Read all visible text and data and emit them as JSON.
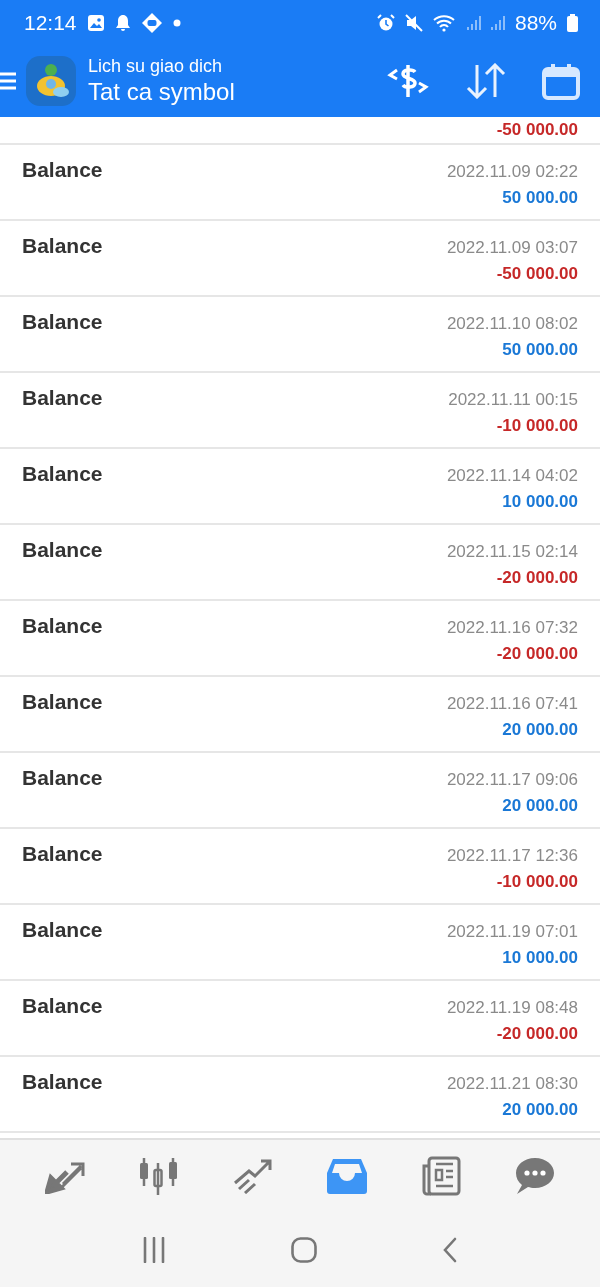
{
  "status_bar": {
    "time": "12:14",
    "battery": "88%"
  },
  "header": {
    "subtitle": "Lich su giao dich",
    "title": "Tat ca symbol"
  },
  "partial_row": {
    "amount": "-50 000.00",
    "color": "#c62828"
  },
  "rows": [
    {
      "name": "Balance",
      "time": "2022.11.09 02:22",
      "amount": "50 000.00",
      "color": "#1a78d6"
    },
    {
      "name": "Balance",
      "time": "2022.11.09 03:07",
      "amount": "-50 000.00",
      "color": "#c62828"
    },
    {
      "name": "Balance",
      "time": "2022.11.10 08:02",
      "amount": "50 000.00",
      "color": "#1a78d6"
    },
    {
      "name": "Balance",
      "time": "2022.11.11 00:15",
      "amount": "-10 000.00",
      "color": "#c62828"
    },
    {
      "name": "Balance",
      "time": "2022.11.14 04:02",
      "amount": "10 000.00",
      "color": "#1a78d6"
    },
    {
      "name": "Balance",
      "time": "2022.11.15 02:14",
      "amount": "-20 000.00",
      "color": "#c62828"
    },
    {
      "name": "Balance",
      "time": "2022.11.16 07:32",
      "amount": "-20 000.00",
      "color": "#c62828"
    },
    {
      "name": "Balance",
      "time": "2022.11.16 07:41",
      "amount": "20 000.00",
      "color": "#1a78d6"
    },
    {
      "name": "Balance",
      "time": "2022.11.17 09:06",
      "amount": "20 000.00",
      "color": "#1a78d6"
    },
    {
      "name": "Balance",
      "time": "2022.11.17 12:36",
      "amount": "-10 000.00",
      "color": "#c62828"
    },
    {
      "name": "Balance",
      "time": "2022.11.19 07:01",
      "amount": "10 000.00",
      "color": "#1a78d6"
    },
    {
      "name": "Balance",
      "time": "2022.11.19 08:48",
      "amount": "-20 000.00",
      "color": "#c62828"
    },
    {
      "name": "Balance",
      "time": "2022.11.21 08:30",
      "amount": "20 000.00",
      "color": "#1a78d6"
    }
  ],
  "bottom_nav": [
    {
      "selected": false
    },
    {
      "selected": false
    },
    {
      "selected": false
    },
    {
      "selected": true
    },
    {
      "selected": false
    },
    {
      "selected": false
    }
  ]
}
